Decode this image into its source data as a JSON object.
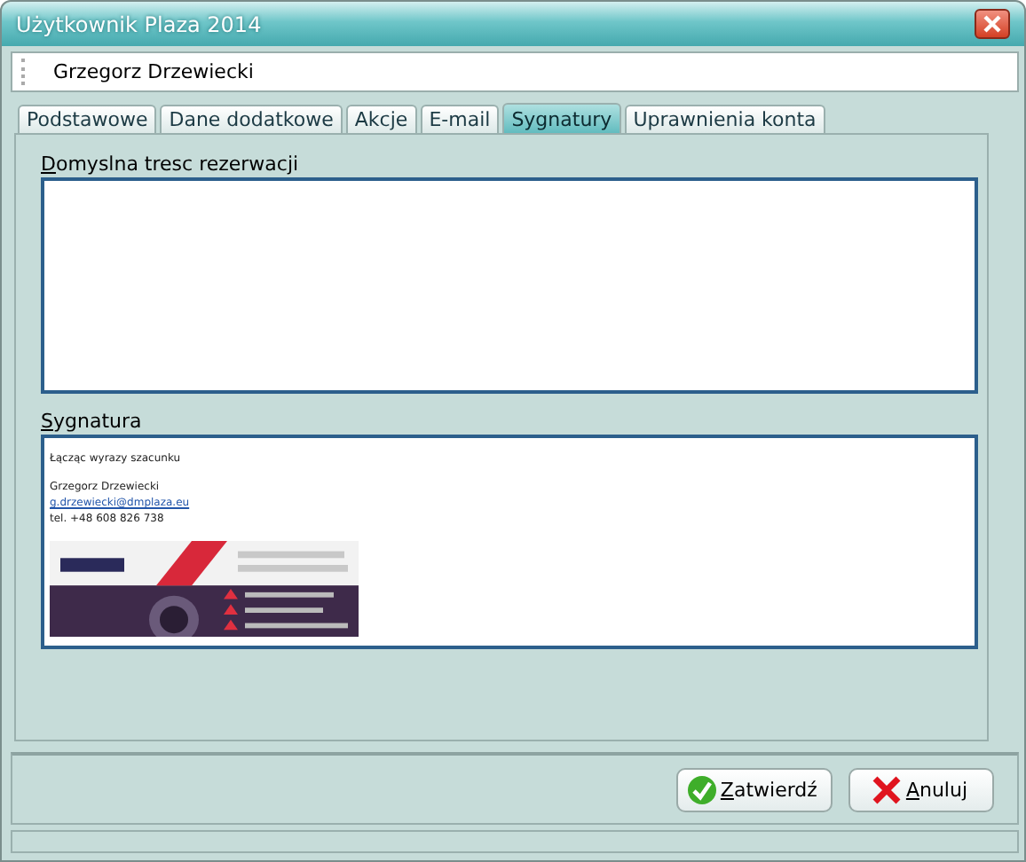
{
  "window": {
    "title": "Użytkownik Plaza 2014"
  },
  "header": {
    "name": "Grzegorz Drzewiecki"
  },
  "tabs": [
    {
      "label": "Podstawowe",
      "selected": false
    },
    {
      "label": "Dane dodatkowe",
      "selected": false
    },
    {
      "label": "Akcje",
      "selected": false
    },
    {
      "label": "E-mail",
      "selected": false
    },
    {
      "label": "Sygnatury",
      "selected": true
    },
    {
      "label": "Uprawnienia konta",
      "selected": false
    }
  ],
  "fields": [
    {
      "label": "Domyslna tresc rezerwacji",
      "underline_first": true,
      "kind": "text"
    },
    {
      "label": "Sygnatura",
      "underline_first": true,
      "kind": "signature",
      "lines": [
        {
          "text": "Łącząc wyrazy szacunku",
          "kind": "text"
        },
        {
          "text": "Grzegorz Drzewiecki",
          "kind": "gap"
        },
        {
          "text": "g.drzewiecki@dmplaza.eu",
          "kind": "link"
        },
        {
          "text": "tel. +48 608 826 738",
          "kind": "text"
        }
      ]
    }
  ],
  "buttons": [
    {
      "label": "Zatwierdź",
      "kind": "confirm",
      "underline_first": true
    },
    {
      "label": "Anuluj",
      "kind": "cancel",
      "underline_first": true
    }
  ]
}
